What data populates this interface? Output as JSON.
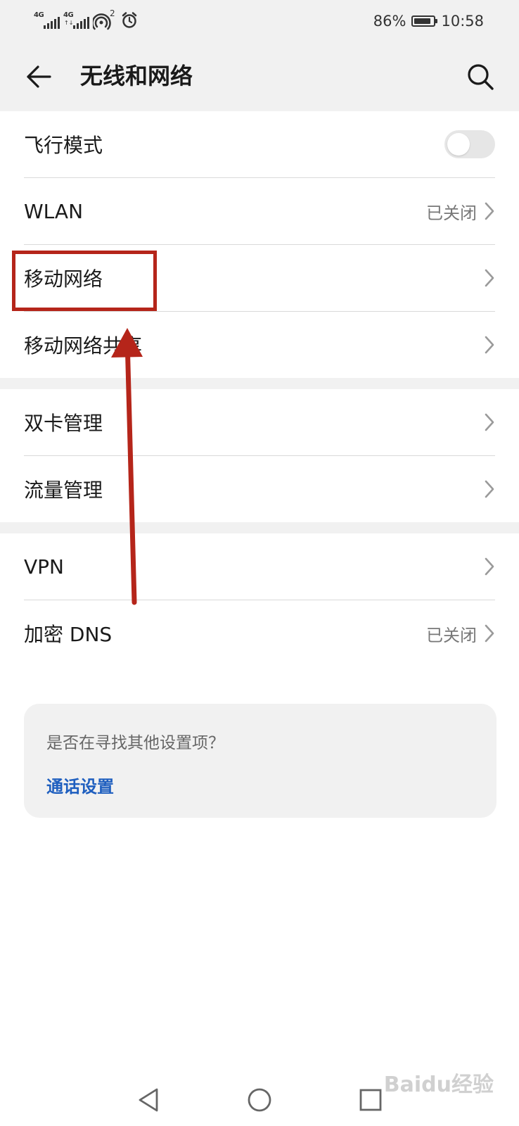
{
  "status_bar": {
    "signal1_label": "4G",
    "signal2_label": "4G",
    "signal2_arrows": "↑↓",
    "hotspot_badge": "2",
    "battery": "86%",
    "battery_level": 0.86,
    "time": "10:58"
  },
  "header": {
    "title": "无线和网络"
  },
  "section1": {
    "airplane_mode": {
      "label": "飞行模式",
      "enabled": false
    },
    "wlan": {
      "label": "WLAN",
      "status": "已关闭"
    },
    "mobile_network": {
      "label": "移动网络"
    },
    "mobile_hotspot": {
      "label": "移动网络共享"
    }
  },
  "section2": {
    "dual_sim": {
      "label": "双卡管理"
    },
    "data_usage": {
      "label": "流量管理"
    }
  },
  "section3": {
    "vpn": {
      "label": "VPN"
    },
    "private_dns": {
      "label": "加密 DNS",
      "status": "已关闭"
    }
  },
  "hint": {
    "question": "是否在寻找其他设置项？",
    "link": "通话设置"
  },
  "watermark": "Baidu经验",
  "colors": {
    "background": "#ffffff",
    "header_bg": "#f1f1f1",
    "link_blue": "#1f5fbf",
    "annotation_red": "#b5251a",
    "secondary_text": "#777777"
  },
  "icons": {
    "back": "arrow-left-icon",
    "search": "search-icon",
    "chevron": "chevron-right-icon",
    "nav_back": "triangle-back-icon",
    "nav_home": "circle-home-icon",
    "nav_recents": "square-recents-icon"
  }
}
